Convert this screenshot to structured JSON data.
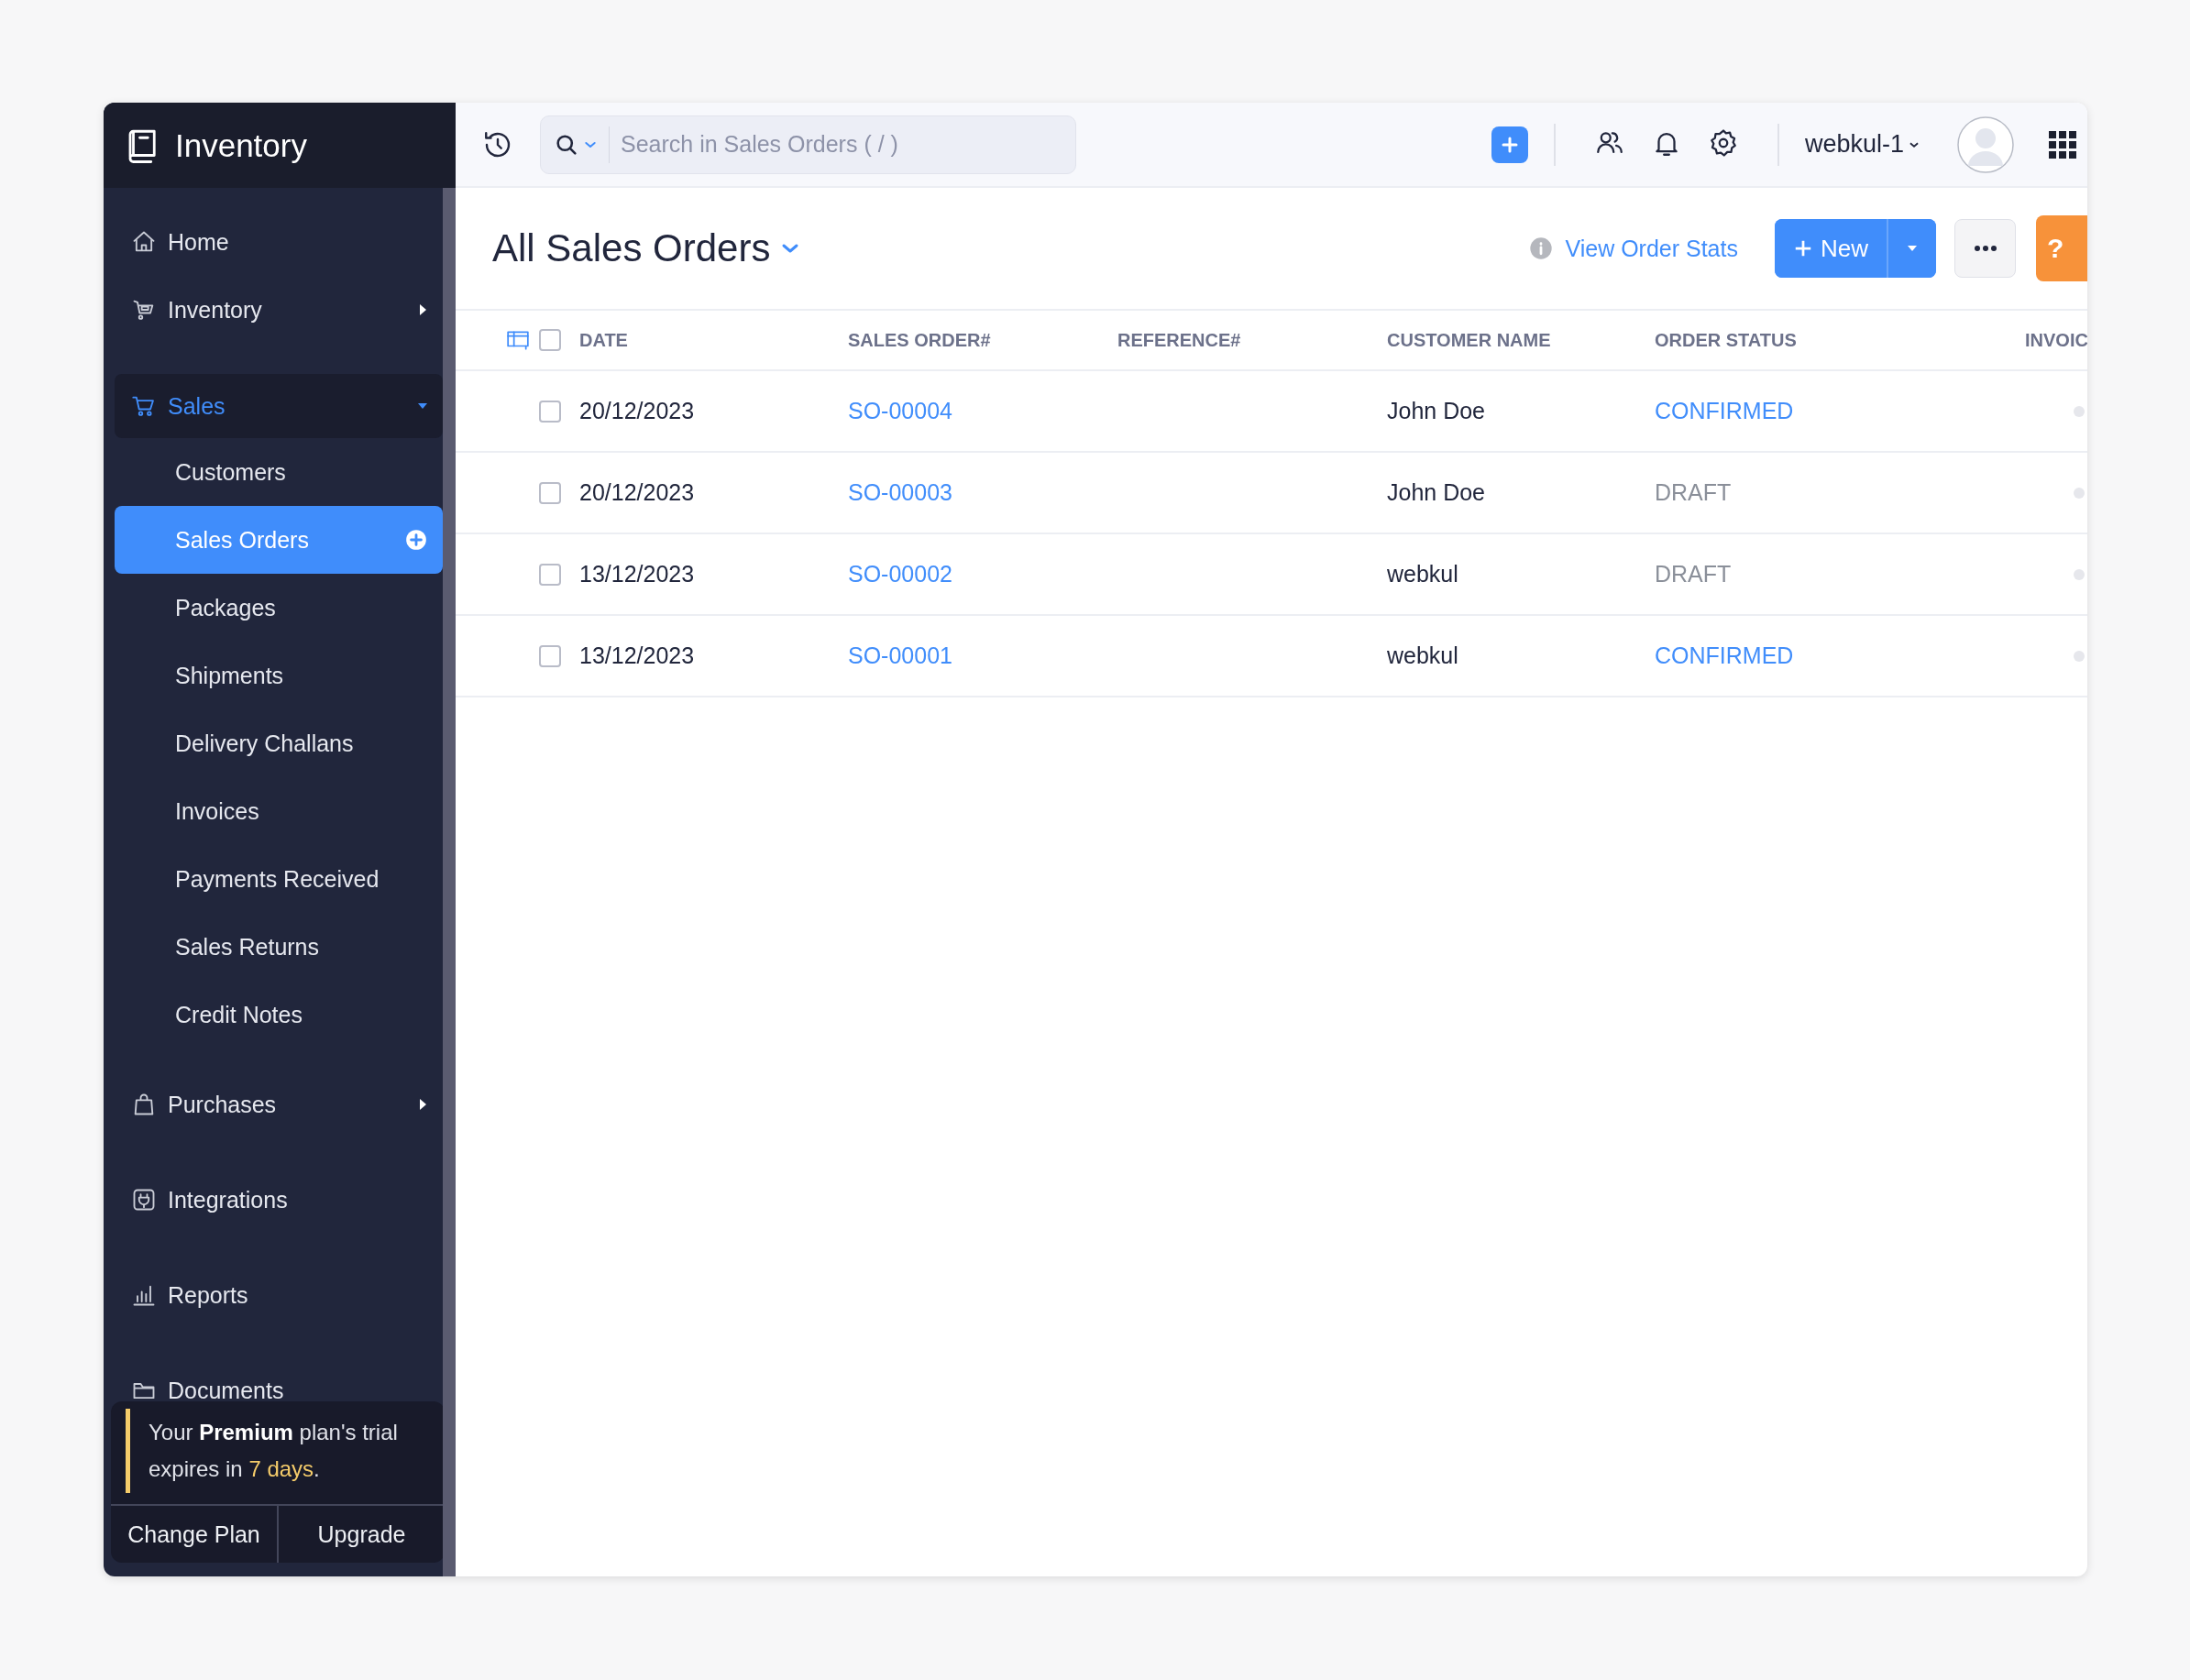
{
  "sidebar": {
    "app_title": "Inventory",
    "nav": [
      {
        "kind": "item",
        "label": "Home",
        "selected": false
      },
      {
        "kind": "group",
        "label": "Inventory",
        "expanded": false
      },
      {
        "kind": "group",
        "label": "Sales",
        "expanded": true,
        "children": [
          {
            "label": "Customers",
            "selected": false
          },
          {
            "label": "Sales Orders",
            "selected": true
          },
          {
            "label": "Packages",
            "selected": false
          },
          {
            "label": "Shipments",
            "selected": false
          },
          {
            "label": "Delivery Challans",
            "selected": false
          },
          {
            "label": "Invoices",
            "selected": false
          },
          {
            "label": "Payments Received",
            "selected": false
          },
          {
            "label": "Sales Returns",
            "selected": false
          },
          {
            "label": "Credit Notes",
            "selected": false
          }
        ]
      },
      {
        "kind": "group",
        "label": "Purchases",
        "expanded": false
      },
      {
        "kind": "item",
        "label": "Integrations",
        "selected": false
      },
      {
        "kind": "item",
        "label": "Reports",
        "selected": false
      },
      {
        "kind": "item",
        "label": "Documents",
        "selected": false
      }
    ],
    "trial_banner": {
      "message": "Your **Premium** plan's trial expires in",
      "highlight": "7 days",
      "end": "."
    },
    "banner_buttons": [
      "Change Plan",
      "Upgrade"
    ]
  },
  "top_bar": {
    "search": {
      "placeholder": "Search in Sales Orders ( / )"
    },
    "user": "webkul-1"
  },
  "header": {
    "title": "All Sales Orders",
    "stats_link": "View Order Stats",
    "new_button": "New",
    "help_button": "?"
  },
  "table": {
    "select_all": {
      "checked": false
    },
    "columns": [
      "DATE",
      "SALES ORDER#",
      "REFERENCE#",
      "CUSTOMER NAME",
      "ORDER STATUS",
      "INVOIC"
    ],
    "rows": [
      {
        "checked": false,
        "date": "20/12/2023",
        "order": "SO-00004",
        "customer": "John Doe",
        "status": {
          "text": "CONFIRMED",
          "color": "#408dfb"
        }
      },
      {
        "checked": false,
        "date": "20/12/2023",
        "order": "SO-00003",
        "customer": "John Doe",
        "status": {
          "text": "DRAFT",
          "color": "#8a8f99"
        }
      },
      {
        "checked": false,
        "date": "13/12/2023",
        "order": "SO-00002",
        "customer": "webkul",
        "status": {
          "text": "DRAFT",
          "color": "#8a8f99"
        }
      },
      {
        "checked": false,
        "date": "13/12/2023",
        "order": "SO-00001",
        "customer": "webkul",
        "status": {
          "text": "CONFIRMED",
          "color": "#408dfb"
        }
      }
    ]
  }
}
